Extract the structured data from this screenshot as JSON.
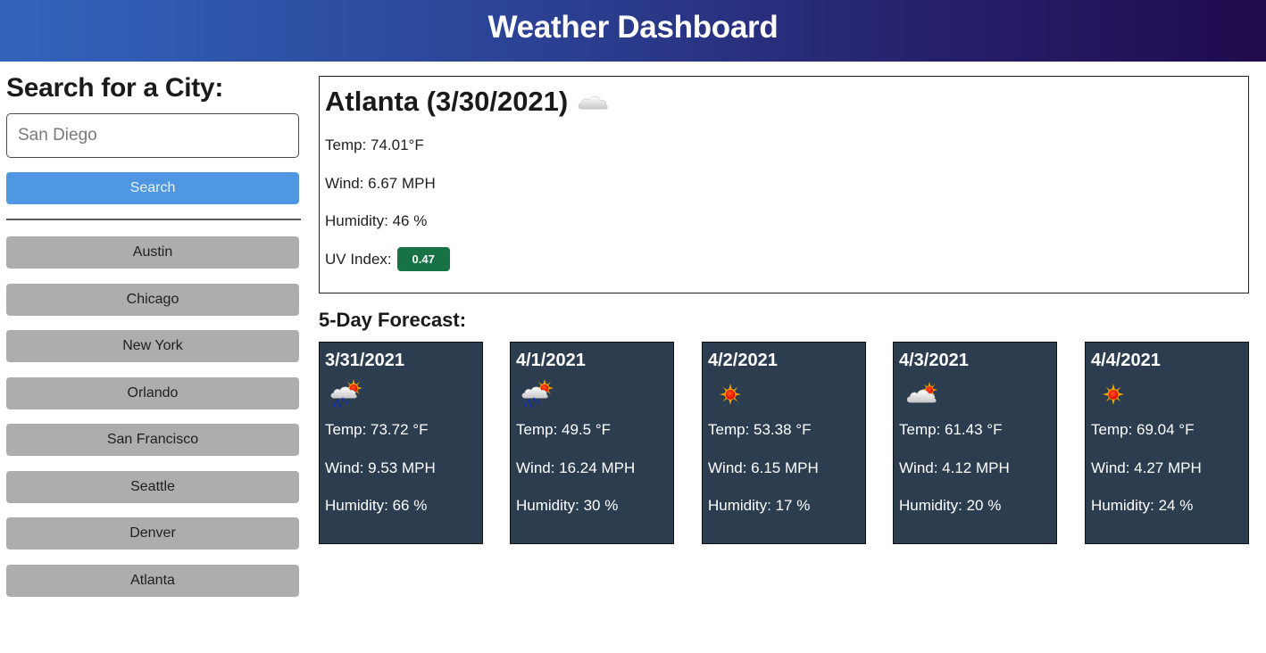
{
  "header": {
    "title": "Weather Dashboard"
  },
  "sidebar": {
    "heading": "Search for a City:",
    "search": {
      "placeholder": "San Diego",
      "value": ""
    },
    "search_button": "Search",
    "history": [
      "Austin",
      "Chicago",
      "New York",
      "Orlando",
      "San Francisco",
      "Seattle",
      "Denver",
      "Atlanta"
    ]
  },
  "current": {
    "title": "Atlanta (3/30/2021)",
    "icon": "cloud-icon",
    "temp": "Temp: 74.01°F",
    "wind": "Wind: 6.67 MPH",
    "humidity": "Humidity: 46 %",
    "uv_label": "UV Index:",
    "uv_value": "0.47",
    "uv_color": "#177245"
  },
  "forecast": {
    "title": "5-Day Forecast:",
    "days": [
      {
        "date": "3/31/2021",
        "icon": "rain-sun-icon",
        "temp": "Temp: 73.72 °F",
        "wind": "Wind: 9.53 MPH",
        "humidity": "Humidity: 66 %"
      },
      {
        "date": "4/1/2021",
        "icon": "rain-sun-icon",
        "temp": "Temp: 49.5 °F",
        "wind": "Wind: 16.24 MPH",
        "humidity": "Humidity: 30 %"
      },
      {
        "date": "4/2/2021",
        "icon": "sun-icon",
        "temp": "Temp: 53.38 °F",
        "wind": "Wind: 6.15 MPH",
        "humidity": "Humidity: 17 %"
      },
      {
        "date": "4/3/2021",
        "icon": "partly-cloudy-icon",
        "temp": "Temp: 61.43 °F",
        "wind": "Wind: 4.12 MPH",
        "humidity": "Humidity: 20 %"
      },
      {
        "date": "4/4/2021",
        "icon": "sun-icon",
        "temp": "Temp: 69.04 °F",
        "wind": "Wind: 4.27 MPH",
        "humidity": "Humidity: 24 %"
      }
    ]
  },
  "colors": {
    "header_gradient_start": "#3264bc",
    "header_gradient_end": "#200b4d",
    "search_button": "#4f97e3",
    "history_button": "#adadad",
    "forecast_card": "#2d3d50"
  }
}
